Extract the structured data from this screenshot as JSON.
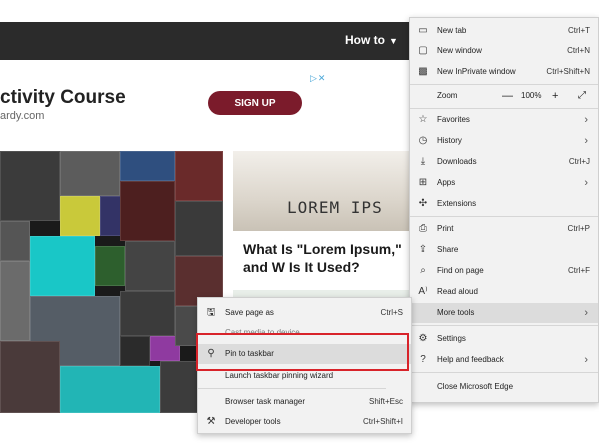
{
  "header": {
    "howto_label": "How to",
    "caret": "▼"
  },
  "ad": {
    "close": "▷✕",
    "title": "ctivity Course",
    "domain": "ardy.com",
    "button": "SIGN UP"
  },
  "article": {
    "image_text": "LOREM IPS",
    "title": "What Is \"Lorem Ipsum,\" and W Is It Used?"
  },
  "menu": {
    "new_tab": {
      "label": "New tab",
      "shortcut": "Ctrl+T"
    },
    "new_window": {
      "label": "New window",
      "shortcut": "Ctrl+N"
    },
    "inprivate": {
      "label": "New InPrivate window",
      "shortcut": "Ctrl+Shift+N"
    },
    "zoom": {
      "label": "Zoom",
      "minus": "—",
      "value": "100%",
      "plus": "+",
      "fullscreen": "⤢"
    },
    "favorites": {
      "label": "Favorites"
    },
    "history": {
      "label": "History"
    },
    "downloads": {
      "label": "Downloads",
      "shortcut": "Ctrl+J"
    },
    "apps": {
      "label": "Apps"
    },
    "extensions": {
      "label": "Extensions"
    },
    "print": {
      "label": "Print",
      "shortcut": "Ctrl+P"
    },
    "share": {
      "label": "Share"
    },
    "find": {
      "label": "Find on page",
      "shortcut": "Ctrl+F"
    },
    "read_aloud": {
      "label": "Read aloud"
    },
    "more_tools": {
      "label": "More tools"
    },
    "settings": {
      "label": "Settings"
    },
    "help": {
      "label": "Help and feedback"
    },
    "close_edge": {
      "label": "Close Microsoft Edge"
    },
    "arrow": "›"
  },
  "submenu": {
    "save_page": {
      "label": "Save page as",
      "shortcut": "Ctrl+S"
    },
    "cast": {
      "label": "Cast media to device"
    },
    "pin_taskbar": {
      "label": "Pin to taskbar"
    },
    "launch_wizard": {
      "label": "Launch taskbar pinning wizard"
    },
    "task_manager": {
      "label": "Browser task manager",
      "shortcut": "Shift+Esc"
    },
    "dev_tools": {
      "label": "Developer tools",
      "shortcut": "Ctrl+Shift+I"
    }
  },
  "colors": {
    "accent_highlight": "#d8232a",
    "ad_button": "#7b1b2b",
    "header": "#2b2b2b"
  }
}
